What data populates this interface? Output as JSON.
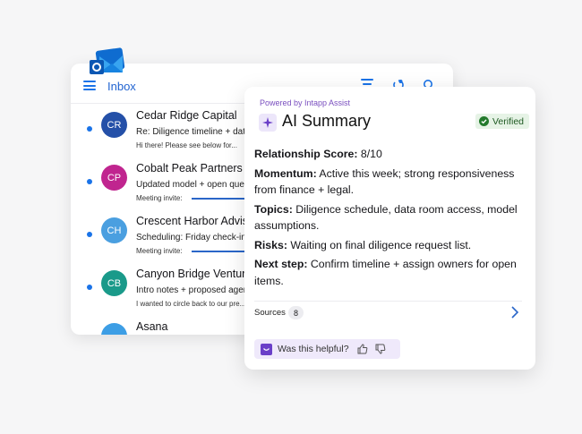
{
  "mail": {
    "title": "Inbox",
    "rows": [
      {
        "initials": "CR",
        "color": "#2450a8",
        "sender": "Cedar Ridge Capital",
        "subject": "Re: Diligence timeline + data",
        "preview": "Hi there! Please see below for..."
      },
      {
        "initials": "CP",
        "color": "#c0258f",
        "sender": "Cobalt Peak Partners",
        "subject": "Updated model + open ques",
        "preview": "Meeting invite:"
      },
      {
        "initials": "CH",
        "color": "#4a9fe0",
        "sender": "Crescent Harbor Advis",
        "subject": "Scheduling: Friday check-in",
        "preview": "Meeting invite:"
      },
      {
        "initials": "CB",
        "color": "#1a9a8a",
        "sender": "Canyon Bridge Ventur",
        "subject": "Intro notes + proposed agen",
        "preview": "I wanted to circle back to our pre..."
      },
      {
        "initials": "",
        "color": "#3d9ee5",
        "sender": "Asana",
        "subject": "",
        "preview": ""
      }
    ]
  },
  "ai": {
    "powered": "Powered by Intapp Assist",
    "title": "AI Summary",
    "verified": "Verified",
    "items": [
      {
        "label": "Relationship Score:",
        "text": " 8/10"
      },
      {
        "label": "Momentum:",
        "text": " Active this week; strong responsiveness from finance + legal."
      },
      {
        "label": "Topics:",
        "text": " Diligence schedule, data room access, model assumptions."
      },
      {
        "label": "Risks:",
        "text": " Waiting on final diligence request list."
      },
      {
        "label": "Next step:",
        "text": " Confirm timeline + assign owners for open items."
      }
    ],
    "sources_label": "Sources",
    "sources_count": "8",
    "helpful": "Was this helpful?"
  }
}
